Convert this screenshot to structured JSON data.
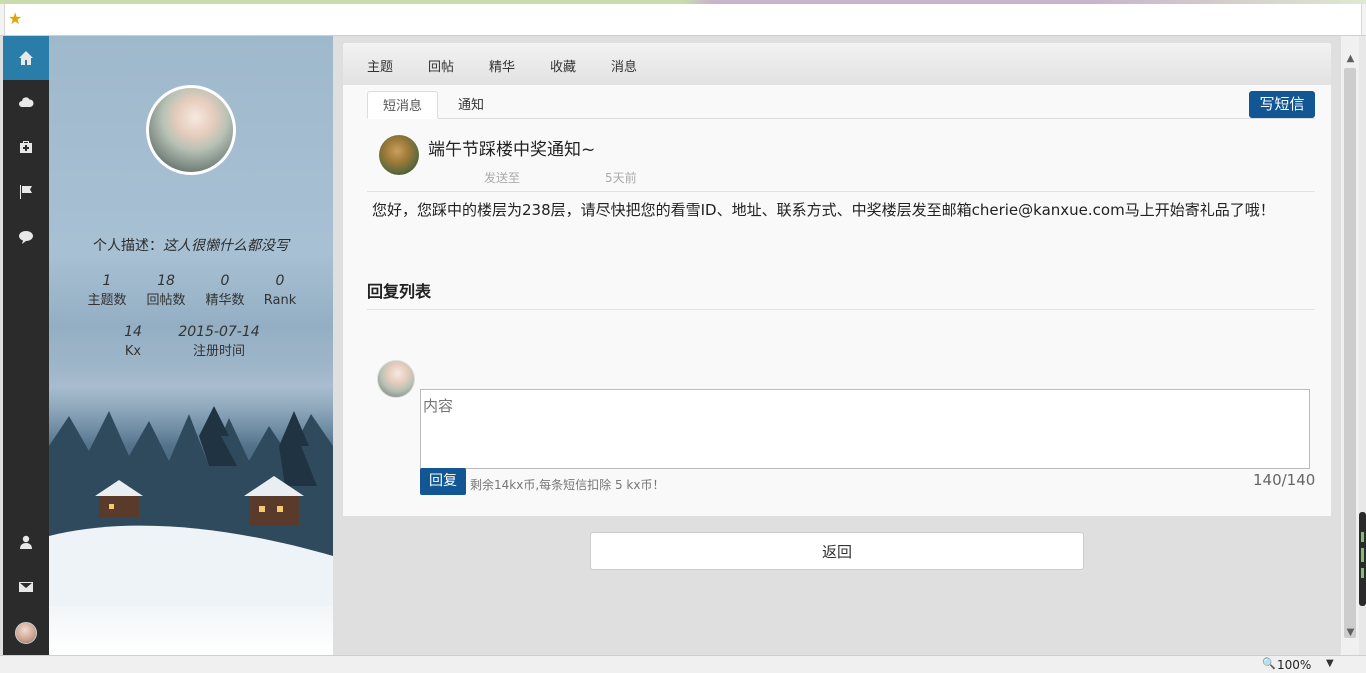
{
  "browser": {
    "favorites_icon": "star-icon"
  },
  "sidebar": {
    "icons": [
      "home-icon",
      "cloud-icon",
      "medkit-icon",
      "flag-icon",
      "comment-icon",
      "user-icon",
      "envelope-icon",
      "avatar-icon"
    ]
  },
  "profile": {
    "desc_label": "个人描述：",
    "desc_text": "这人很懒什么都没写",
    "stats": [
      {
        "value": "1",
        "label": "主题数"
      },
      {
        "value": "18",
        "label": "回帖数"
      },
      {
        "value": "0",
        "label": "精华数"
      },
      {
        "value": "0",
        "label": "Rank"
      },
      {
        "value": "14",
        "label": "Kx"
      },
      {
        "value": "2015-07-14",
        "label": "注册时间"
      }
    ]
  },
  "nav": {
    "items": [
      "主题",
      "回帖",
      "精华",
      "收藏",
      "消息"
    ]
  },
  "tabs": {
    "items": [
      "短消息",
      "通知"
    ],
    "active": 0
  },
  "compose": {
    "label": "写短信"
  },
  "message": {
    "title": "端午节踩楼中奖通知~",
    "sent_to": "发送至",
    "time": "5天前",
    "body": "您好，您踩中的楼层为238层，请尽快把您的看雪ID、地址、联系方式、中奖楼层发至邮箱cherie@kanxue.com马上开始寄礼品了哦！"
  },
  "reply": {
    "section_title": "回复列表",
    "placeholder": "内容",
    "button": "回复",
    "hint": "剩余14kx币,每条短信扣除 5 kx币！",
    "count": "140/140"
  },
  "back": {
    "label": "返回"
  },
  "statusbar": {
    "zoom": "100%"
  },
  "colors": {
    "primary": "#125693",
    "active_tab": "#2a7da9",
    "sidebar_dark": "#2b2b2b"
  }
}
